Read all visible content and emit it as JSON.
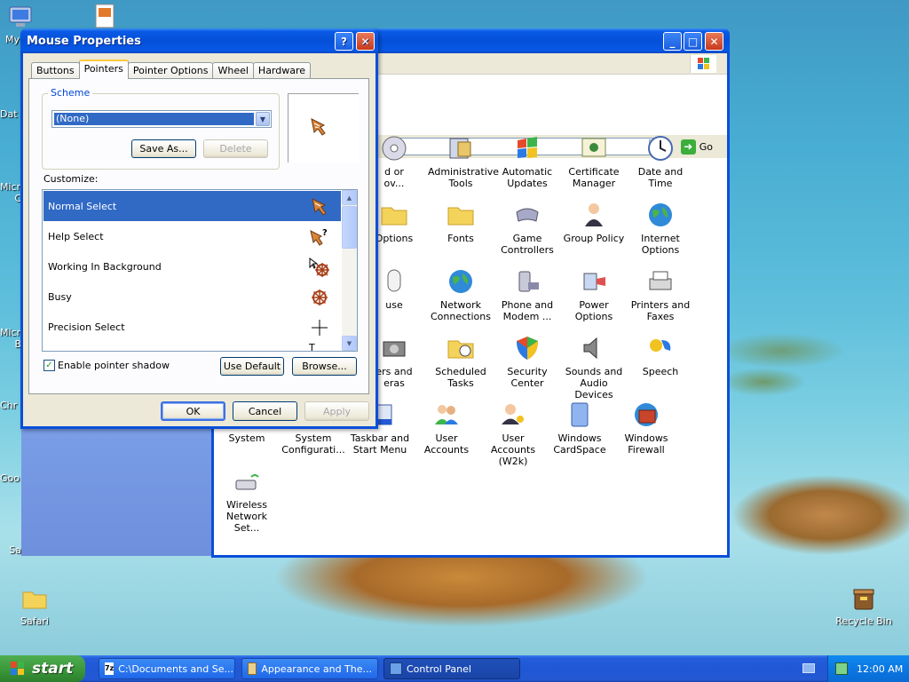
{
  "desktop": {
    "icons": [
      {
        "label": "My",
        "icon": "computer-icon"
      },
      {
        "label": "Dat",
        "icon": "document-icon"
      },
      {
        "label": "Micro",
        "icon": "app-icon"
      },
      {
        "label": "C",
        "icon": "app-icon"
      },
      {
        "label": "Micro",
        "icon": "app-icon"
      },
      {
        "label": "B",
        "icon": "app-icon"
      },
      {
        "label": "Chr",
        "icon": "app-icon"
      },
      {
        "label": "Goo",
        "icon": "app-icon"
      },
      {
        "label": "Sa",
        "icon": "app-icon"
      },
      {
        "label": "Safari",
        "icon": "folder-icon"
      },
      {
        "label": "Recycle Bin",
        "icon": "recycle-bin-icon"
      }
    ]
  },
  "control_panel": {
    "go_label": "Go",
    "items": [
      {
        "label": "d or\nov...",
        "icon": "sound-disc"
      },
      {
        "label": "Administrative\nTools",
        "icon": "admin-tools"
      },
      {
        "label": "Automatic\nUpdates",
        "icon": "windows-flag"
      },
      {
        "label": "Certificate\nManager",
        "icon": "certificate"
      },
      {
        "label": "Date and Time",
        "icon": "clock"
      },
      {
        "label": "Options",
        "icon": "folder"
      },
      {
        "label": "Fonts",
        "icon": "folder"
      },
      {
        "label": "Game\nControllers",
        "icon": "gamepad"
      },
      {
        "label": "Group Policy",
        "icon": "person"
      },
      {
        "label": "Internet\nOptions",
        "icon": "globe"
      },
      {
        "label": "use",
        "icon": "mouse"
      },
      {
        "label": "Network\nConnections",
        "icon": "globe"
      },
      {
        "label": "Phone and\nModem ...",
        "icon": "phone"
      },
      {
        "label": "Power Options",
        "icon": "power"
      },
      {
        "label": "Printers and\nFaxes",
        "icon": "printer"
      },
      {
        "label": "ers and\neras",
        "icon": "camera"
      },
      {
        "label": "Scheduled\nTasks",
        "icon": "folder-clock"
      },
      {
        "label": "Security\nCenter",
        "icon": "shield"
      },
      {
        "label": "Sounds and\nAudio Devices",
        "icon": "speaker"
      },
      {
        "label": "Speech",
        "icon": "speech"
      },
      {
        "label": "System",
        "icon": "computer"
      },
      {
        "label": "System\nConfigurati...",
        "icon": "computer"
      },
      {
        "label": "Taskbar and\nStart Menu",
        "icon": "taskbar"
      },
      {
        "label": "User Accounts",
        "icon": "users"
      },
      {
        "label": "User Accounts\n(W2k)",
        "icon": "users-key"
      },
      {
        "label": "Windows\nCardSpace",
        "icon": "card"
      },
      {
        "label": "Windows\nFirewall",
        "icon": "firewall"
      },
      {
        "label": "Wireless\nNetwork Set...",
        "icon": "wireless"
      }
    ]
  },
  "dialog": {
    "title": "Mouse Properties",
    "tabs": [
      "Buttons",
      "Pointers",
      "Pointer Options",
      "Wheel",
      "Hardware"
    ],
    "active_tab": "Pointers",
    "scheme_label": "Scheme",
    "scheme_value": "(None)",
    "save_as_label": "Save As...",
    "delete_label": "Delete",
    "customize_label": "Customize:",
    "pointers": [
      {
        "label": "Normal Select",
        "selected": true,
        "icon": "shell-cursor"
      },
      {
        "label": "Help Select",
        "selected": false,
        "icon": "shell-help-cursor"
      },
      {
        "label": "Working In Background",
        "selected": false,
        "icon": "wheel-arrow-cursor"
      },
      {
        "label": "Busy",
        "selected": false,
        "icon": "wheel-cursor"
      },
      {
        "label": "Precision Select",
        "selected": false,
        "icon": "crosshair-cursor"
      }
    ],
    "shadow_label": "Enable pointer shadow",
    "shadow_checked": true,
    "use_default_label": "Use Default",
    "browse_label": "Browse...",
    "ok_label": "OK",
    "cancel_label": "Cancel",
    "apply_label": "Apply"
  },
  "taskbar": {
    "start_label": "start",
    "buttons": [
      {
        "label": "C:\\Documents and Se...",
        "icon": "7zip-icon",
        "active": false
      },
      {
        "label": "Appearance and The...",
        "icon": "pencil-icon",
        "active": false
      },
      {
        "label": "Control Panel",
        "icon": "control-panel-icon",
        "active": true
      }
    ],
    "clock": "12:00 AM"
  },
  "colors": {
    "xp_blue": "#0a4fd8",
    "selection": "#316ac5",
    "start_green": "#3c9a3c"
  }
}
